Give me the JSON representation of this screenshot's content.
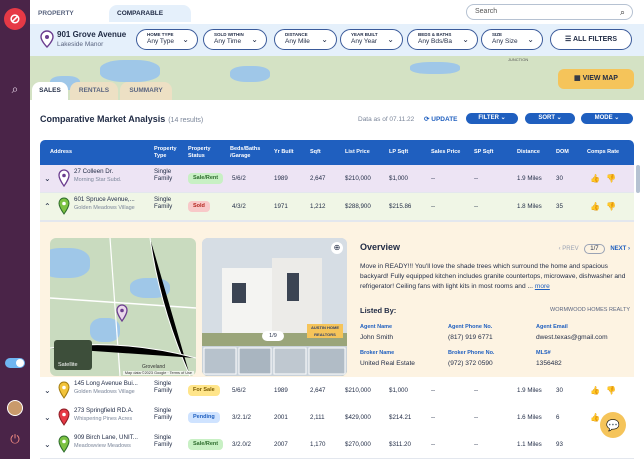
{
  "tabs": {
    "property_details": "PROPERTY DETAILS",
    "comparable_sales": "COMPARABLE SALES"
  },
  "search": {
    "placeholder": "Search"
  },
  "subject": {
    "address": "901 Grove Avenue",
    "subdivision": "Lakeside Manor"
  },
  "filters": [
    {
      "label": "HOME TYPE",
      "value": "Any Type"
    },
    {
      "label": "SOLD WITHIN",
      "value": "Any Time"
    },
    {
      "label": "DISTANCE",
      "value": "Any Mile"
    },
    {
      "label": "YEAR BUILT",
      "value": "Any Year"
    },
    {
      "label": "BEDS & BATHS",
      "value": "Any Bds/Ba"
    },
    {
      "label": "SIZE",
      "value": "Any Size"
    }
  ],
  "all_filters": "ALL FILTERS",
  "map": {
    "view_map": "VIEW MAP",
    "junction_label": "JUNCTION"
  },
  "subtabs": {
    "sales": "SALES",
    "rentals": "RENTALS",
    "summary": "SUMMARY"
  },
  "panel": {
    "title": "Comparative Market Analysis",
    "result_count": "(14 results)",
    "data_as_of": "Data as of 07.11.22",
    "update": "UPDATE",
    "filter": "FILTER",
    "sort": "SORT",
    "mode": "MODE"
  },
  "columns": {
    "address": "Address",
    "property_type": "Property Type",
    "property_status": "Property Status",
    "beds_baths_garage": "Beds/Baths /Garage",
    "yr_built": "Yr Built",
    "sqft": "Sqft",
    "list_price": "List Price",
    "lp_sqft": "LP Sqft",
    "sales_price": "Sales Price",
    "sp_sqft": "SP Sqft",
    "distance": "Distance",
    "dom": "DOM",
    "comps_rate": "Comps Rate"
  },
  "rows": [
    {
      "address": "27 Colleen  Dr.",
      "subdivision": "Morning Star Subd.",
      "type": "Single Family",
      "status": "Sale/Rent",
      "bbg": "5/6/2",
      "yr": "1989",
      "sqft": "2,647",
      "lp": "$210,000",
      "lpsqft": "$1,000",
      "sp": "--",
      "spsqft": "--",
      "distance": "1.9 Miles",
      "dom": "30"
    },
    {
      "address": "601 Spruce Avenue,...",
      "subdivision": "Golden Meadows Village",
      "type": "Single Family",
      "status": "Sold",
      "bbg": "4/3/2",
      "yr": "1971",
      "sqft": "1,212",
      "lp": "$288,900",
      "lpsqft": "$215.86",
      "sp": "--",
      "spsqft": "--",
      "distance": "1.8 Miles",
      "dom": "35"
    },
    {
      "address": "145 Long Avenue Bui...",
      "subdivision": "Golden Meadows Village",
      "type": "Single Family",
      "status": "For Sale",
      "bbg": "5/6/2",
      "yr": "1989",
      "sqft": "2,647",
      "lp": "$210,000",
      "lpsqft": "$1,000",
      "sp": "--",
      "spsqft": "--",
      "distance": "1.9 Miles",
      "dom": "30"
    },
    {
      "address": "273 Springfield RD.A.",
      "subdivision": "Whispering Pines Acres",
      "type": "Single Family",
      "status": "Pending",
      "bbg": "3/2.1/2",
      "yr": "2001",
      "sqft": "2,111",
      "lp": "$429,000",
      "lpsqft": "$214.21",
      "sp": "--",
      "spsqft": "--",
      "distance": "1.6 Miles",
      "dom": "6"
    },
    {
      "address": "909 Birch Lane, UNIT...",
      "subdivision": "Meadowview Meadows",
      "type": "Single Family",
      "status": "Sale/Rent",
      "bbg": "3/2.0/2",
      "yr": "2007",
      "sqft": "1,170",
      "lp": "$270,000",
      "lpsqft": "$311.20",
      "sp": "--",
      "spsqft": "--",
      "distance": "1.1 Miles",
      "dom": "93"
    }
  ],
  "detail": {
    "map_satellite": "Satellite",
    "map_attribution": "Map data ©2023 Google · Terms of Use",
    "map_labels": {
      "groveland": "Groveland"
    },
    "photo_counter": "1/9",
    "photo_brand": "AUSTIN HOME REALTORS",
    "overview_title": "Overview",
    "prev": "PREV",
    "page": "1/7",
    "next": "NEXT",
    "description": "Move in READY!!! You'll love the shade trees which surround the home and spacious backyard! Fully equipped kitchen includes granite countertops, microwave, dishwasher and refrigerator! Ceiling fans with light kits in most rooms and ...",
    "more": "more",
    "listed_by": "Listed By:",
    "realty": "WORMWOOD HOMES REALTY",
    "agent_name_label": "Agent Name",
    "agent_name": "John Smith",
    "agent_phone_label": "Agent Phone No.",
    "agent_phone": "(817) 919 6771",
    "agent_email_label": "Agent Email",
    "agent_email": "dwest.texas@gmail.com",
    "broker_name_label": "Broker Name",
    "broker_name": "United Real Estate",
    "broker_phone_label": "Broker Phone No.",
    "broker_phone": "(972) 372 0590",
    "mls_label": "MLS#",
    "mls": "1356482"
  },
  "colors": {
    "primary": "#1f5fbf",
    "sidebar": "#4a2448",
    "accent": "#f5c45a",
    "sold": "#f8c9c9",
    "for_sale": "#ffe58a",
    "pending": "#cfe3ff",
    "sale_rent": "#c8f0c4"
  }
}
